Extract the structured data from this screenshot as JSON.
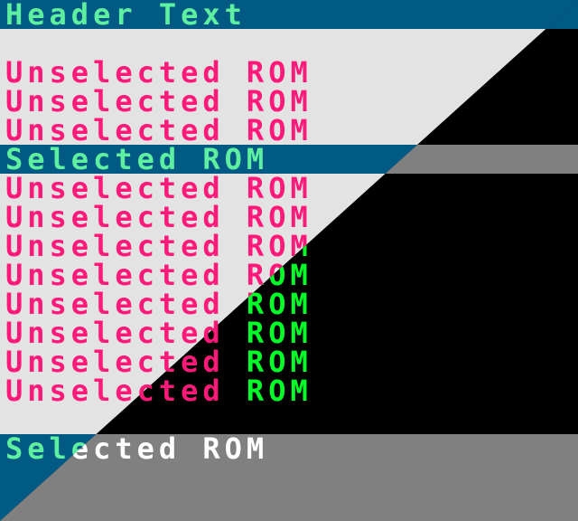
{
  "header": {
    "text": "Header Text"
  },
  "rom_list": {
    "unselected_label": "Unselected",
    "rom_label": "ROM",
    "selected_label": "Selected ROM",
    "rows": [
      {
        "label": "Unselected",
        "rom": "ROM"
      },
      {
        "label": "Unselected",
        "rom": "ROM"
      },
      {
        "label": "Unselected",
        "rom": "ROM"
      },
      {
        "label": "Selected ROM",
        "selected": true
      },
      {
        "label": "Unselected",
        "rom": "ROM"
      },
      {
        "label": "Unselected",
        "rom": "ROM"
      },
      {
        "label": "Unselected",
        "rom": "ROM"
      },
      {
        "label": "Unselected",
        "rom": "ROM"
      },
      {
        "label": "Unselected",
        "rom": "ROM"
      },
      {
        "label": "Unselected",
        "rom": "ROM"
      },
      {
        "label": "Unselected",
        "rom": "ROM"
      },
      {
        "label": "Unselected",
        "rom": "ROM"
      }
    ]
  },
  "footer": {
    "selected_text": "Selected ROM"
  },
  "colors": {
    "header_bg": "#005a84",
    "header_text": "#5ef0a0",
    "light_bg": "#e3e3e3",
    "dark_bg": "#000000",
    "unselected_text": "#ff1a7a",
    "rom_tag_dark": "#00ff28",
    "selected_bg_dark": "#808080",
    "selected_text_dark": "#ffffff"
  }
}
